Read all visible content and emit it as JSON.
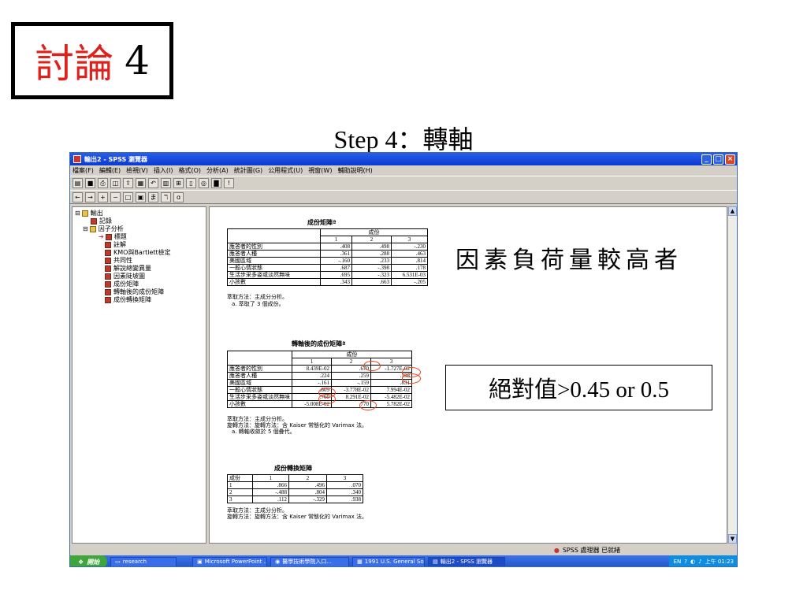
{
  "slide": {
    "title_red": "討論",
    "title_num": "4",
    "step": "Step 4：轉軸",
    "annotation_high": "因素負荷量較高者",
    "annotation_abs": "絕對值>0.45 or 0.5"
  },
  "window": {
    "title": "輸出2 - SPSS 瀏覽器",
    "menu": [
      "檔案(F)",
      "編輯(E)",
      "檢視(V)",
      "插入(I)",
      "格式(O)",
      "分析(A)",
      "統計圖(G)",
      "公用程式(U)",
      "視窗(W)",
      "輔助說明(H)"
    ],
    "status": "SPSS 處理器 已就緒"
  },
  "tree": {
    "root": "輸出",
    "log": "記錄",
    "factor": "因子分析",
    "items": [
      "標題",
      "註解",
      "KMO與Bartlett檢定",
      "共同性",
      "解說總變異量",
      "因素陡坡圖",
      "成份矩陣",
      "轉軸後的成份矩陣",
      "成份轉換矩陣"
    ]
  },
  "table1": {
    "title": "成份矩陣ª",
    "group_header": "成份",
    "cols": [
      "1",
      "2",
      "3"
    ],
    "rows": [
      {
        "label": "應答者的性別",
        "v": [
          ".408",
          ".498",
          "-.230"
        ]
      },
      {
        "label": "應答者人種",
        "v": [
          ".361",
          ".288",
          ".463"
        ]
      },
      {
        "label": "美國區域",
        "v": [
          "-.160",
          ".233",
          ".814"
        ]
      },
      {
        "label": "一般心情狀態",
        "v": [
          ".687",
          "-.398",
          ".178"
        ]
      },
      {
        "label": "生活步采多姿或淡然無味",
        "v": [
          ".695",
          "-.323",
          "6.531E-03"
        ]
      },
      {
        "label": "小孩數",
        "v": [
          ".343",
          ".663",
          "-.205"
        ]
      }
    ],
    "notes": [
      "萃取方法：主成分分析。",
      "a. 萃取了 3 個成份。"
    ]
  },
  "table2": {
    "title": "轉軸後的成份矩陣ª",
    "group_header": "成份",
    "cols": [
      "1",
      "2",
      "3"
    ],
    "rows": [
      {
        "label": "應答者的性別",
        "v": [
          "8.439E-02",
          ".670",
          "-1.727E-02"
        ]
      },
      {
        "label": "應答者人種",
        "v": [
          ".224",
          ".259",
          ".558"
        ]
      },
      {
        "label": "美國區域",
        "v": [
          "-.161",
          "-.159",
          ".831"
        ]
      },
      {
        "label": "一般心情狀態",
        "v": [
          ".809",
          "-3.778E-02",
          "7.994E-02"
        ]
      },
      {
        "label": "生活步采多姿或淡然無味",
        "v": [
          ".760",
          "8.291E-02",
          "-5.482E-02"
        ]
      },
      {
        "label": "小孩數",
        "v": [
          "-5.008E-02",
          ".770",
          "5.782E-02"
        ]
      }
    ],
    "notes": [
      "萃取方法：主成分分析。",
      "旋轉方法：旋轉方法：含 Kaiser 常態化的 Varimax 法。",
      "a. 轉軸收斂於 5 個疊代。"
    ]
  },
  "table3": {
    "title": "成份轉換矩陣",
    "corner": "成份",
    "cols": [
      "1",
      "2",
      "3"
    ],
    "rows": [
      {
        "label": "1",
        "v": [
          ".866",
          ".496",
          ".070"
        ]
      },
      {
        "label": "2",
        "v": [
          "-.488",
          ".804",
          ".340"
        ]
      },
      {
        "label": "3",
        "v": [
          ".112",
          "-.329",
          ".938"
        ]
      }
    ],
    "notes": [
      "萃取方法：主成分分析。",
      "旋轉方法：旋轉方法：含 Kaiser 常態化的 Varimax 法。"
    ]
  },
  "taskbar": {
    "start": "開始",
    "tasks": [
      "research",
      "Microsoft PowerPoint ...",
      "醫學技術學院入口...",
      "1991 U.S. General Soc...",
      "輸出2 - SPSS 瀏覽器"
    ],
    "lang": "EN",
    "clock": "上午 01:23"
  }
}
